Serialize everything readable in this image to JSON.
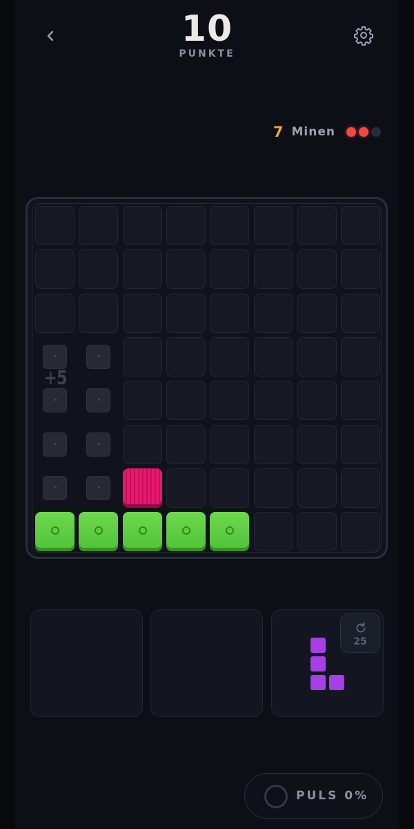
{
  "header": {
    "score": "10",
    "score_label": "PUNKTE",
    "back_icon": "chevron-left-icon",
    "settings_icon": "gear-icon"
  },
  "mines": {
    "count": "7",
    "label": "Minen",
    "lives_total": 3,
    "lives_remaining": 2,
    "life_color_on": "#ef4a42",
    "life_color_off": "#2a2d35"
  },
  "board": {
    "rows": 8,
    "cols": 8,
    "bonus_label": "+5",
    "mine_cells": [
      [
        3,
        0
      ],
      [
        3,
        1
      ],
      [
        4,
        0
      ],
      [
        4,
        1
      ],
      [
        5,
        0
      ],
      [
        5,
        1
      ],
      [
        6,
        0
      ],
      [
        6,
        1
      ]
    ],
    "green_cells": [
      [
        7,
        0
      ],
      [
        7,
        1
      ],
      [
        7,
        2
      ],
      [
        7,
        3
      ],
      [
        7,
        4
      ]
    ],
    "pink_cells": [
      [
        6,
        2
      ]
    ],
    "colors": {
      "green": "#5ccb3f",
      "pink": "#e8186f",
      "empty": "#161923"
    }
  },
  "tray": {
    "slots": 3,
    "rotate_count": "25",
    "rotate_icon": "rotate-icon",
    "piece_color": "#a63fe6",
    "piece_shape": [
      [
        0,
        0
      ],
      [
        1,
        0
      ],
      [
        2,
        0
      ],
      [
        2,
        1
      ]
    ]
  },
  "pulse": {
    "label": "PULS 0%",
    "value": 0
  }
}
